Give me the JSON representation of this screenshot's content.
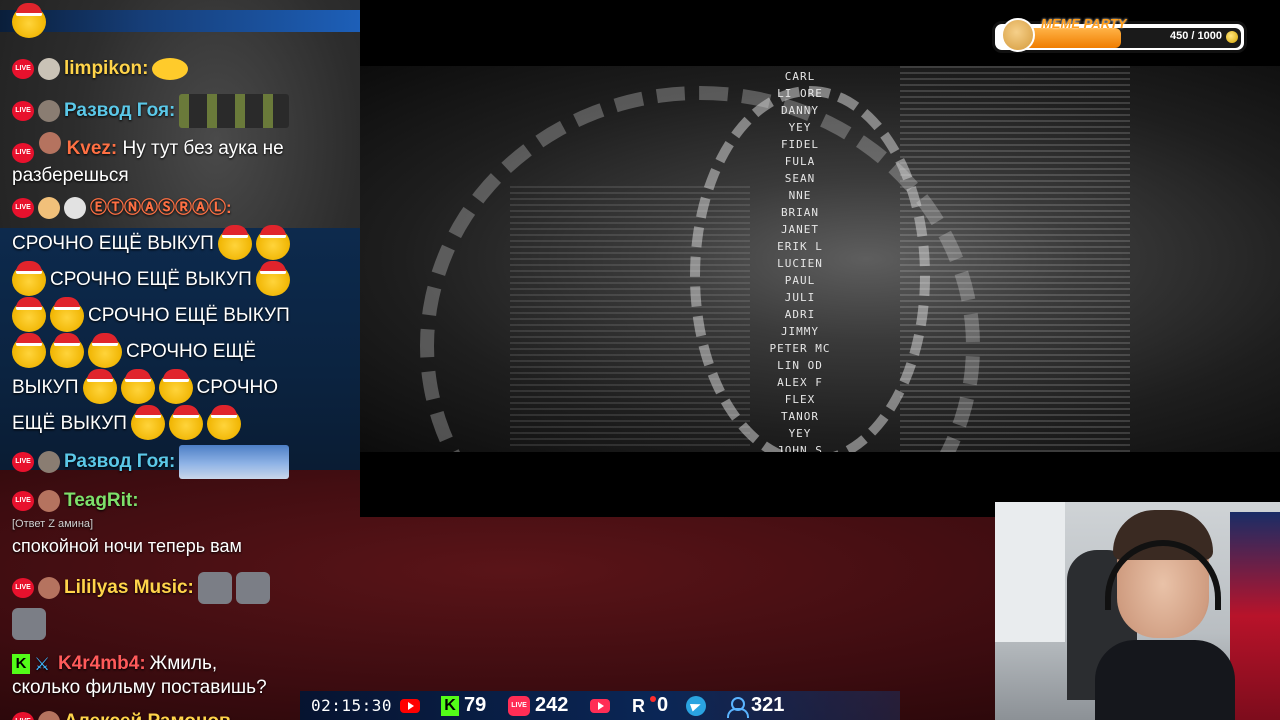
{
  "meme_party": {
    "title": "MEME PARTY",
    "progress": "450 / 1000",
    "current": 450,
    "max": 1000,
    "accent": "#f07d00"
  },
  "video": {
    "credits": [
      "CARL",
      "LI ORE",
      "DANNY",
      "YEY",
      "FIDEL",
      "FULA",
      "SEAN",
      "NNE",
      "BRIAN",
      "JANET",
      "ERIK L",
      "LUCIEN",
      "PAUL",
      "JULI",
      "ADRI",
      "JIMMY",
      "PETER MC",
      "LIN OD",
      "ALEX F",
      "FLEX",
      "TANOR",
      "YEY",
      "JOHN S"
    ]
  },
  "chat": {
    "messages": [
      {
        "user": "limpikon:",
        "user_color": "#ffd44a",
        "text": "",
        "emotes": [
          "laugh-emote"
        ]
      },
      {
        "user": "Развод Гоя:",
        "user_color": "#5bc8e8",
        "text": "",
        "emotes": [
          "image-emote"
        ]
      },
      {
        "user": "Kvez:",
        "user_color": "#ff7043",
        "text": "Ну тут без аука не разберешься"
      },
      {
        "user": "ⒺⓉⓃⒶⓈⓇⒶⓁ:",
        "user_color": "#ff7043",
        "text": "СРОЧНО ЕЩЁ ВЫКУП",
        "line2": "СРОЧНО ЕЩЁ ВЫКУП",
        "line3": "СРОЧНО ЕЩЁ ВЫКУП",
        "line4": "СРОЧНО ЕЩЁ",
        "line5a": "ВЫКУП",
        "line5b": "СРОЧНО",
        "line6": "ЕЩЁ ВЫКУП"
      },
      {
        "user": "Развод Гоя:",
        "user_color": "#5bc8e8",
        "text": "",
        "emotes": [
          "image-emote"
        ]
      },
      {
        "user": "TeagRit:",
        "user_color": "#7ee06a",
        "reply": "[Ответ Z амина]",
        "text": "спокойной ночи теперь вам"
      },
      {
        "user": "Lililyas Music:",
        "user_color": "#ffd44a",
        "text": "",
        "emotes": [
          "rat-emote"
        ]
      },
      {
        "user": "K4r4mb4:",
        "user_color": "#ff5a5a",
        "text": "Жмиль,",
        "text2": "сколько фильму поставишь?"
      },
      {
        "user": "Алексей Рамонов",
        "user_color": "#ffd44a",
        "text": ""
      }
    ]
  },
  "stats": {
    "time": "02:15:30",
    "kick": "79",
    "vk_live": "242",
    "rutube": "0",
    "viewers": "321"
  },
  "live_badge": "LIVE"
}
